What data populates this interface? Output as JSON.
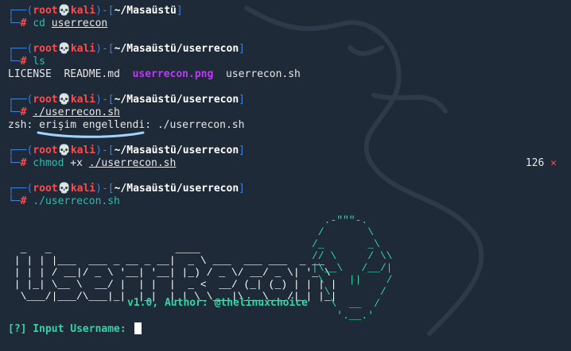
{
  "prompt": {
    "user": "root",
    "skull": "💀",
    "host": "kali"
  },
  "blocks": [
    {
      "path": "~/Masaüstü",
      "command": "cd",
      "arg": "userrecon"
    },
    {
      "path": "~/Masaüstü/userrecon",
      "command": "ls"
    },
    {
      "path": "~/Masaüstü/userrecon",
      "command": "./userrecon.sh"
    },
    {
      "path": "~/Masaüstü/userrecon",
      "command": "chmod",
      "arg1": "+x",
      "arg2": "./userrecon.sh",
      "exit_code": "126",
      "exit_mark": "✕"
    },
    {
      "path": "~/Masaüstü/userrecon",
      "command": "./userrecon.sh"
    }
  ],
  "ls_output": {
    "f1": "LICENSE",
    "f2": "README.md",
    "f3": "userrecon.png",
    "f4": "userrecon.sh"
  },
  "error_line": {
    "prefix": "zsh: ",
    "message": "erişim engellendi",
    "suffix": ": ./userrecon.sh"
  },
  "banner": {
    "version": "v1.0, Author: @thelinuxchoice",
    "input_prefix": "[?]",
    "input_label": " Input Username: "
  },
  "colors": {
    "background": "#1e2a38",
    "prompt_box": "#3d7fd9",
    "root_red": "#ff4b4b",
    "banner_green": "#2fd6a6",
    "png_purple": "#b83cf0"
  }
}
